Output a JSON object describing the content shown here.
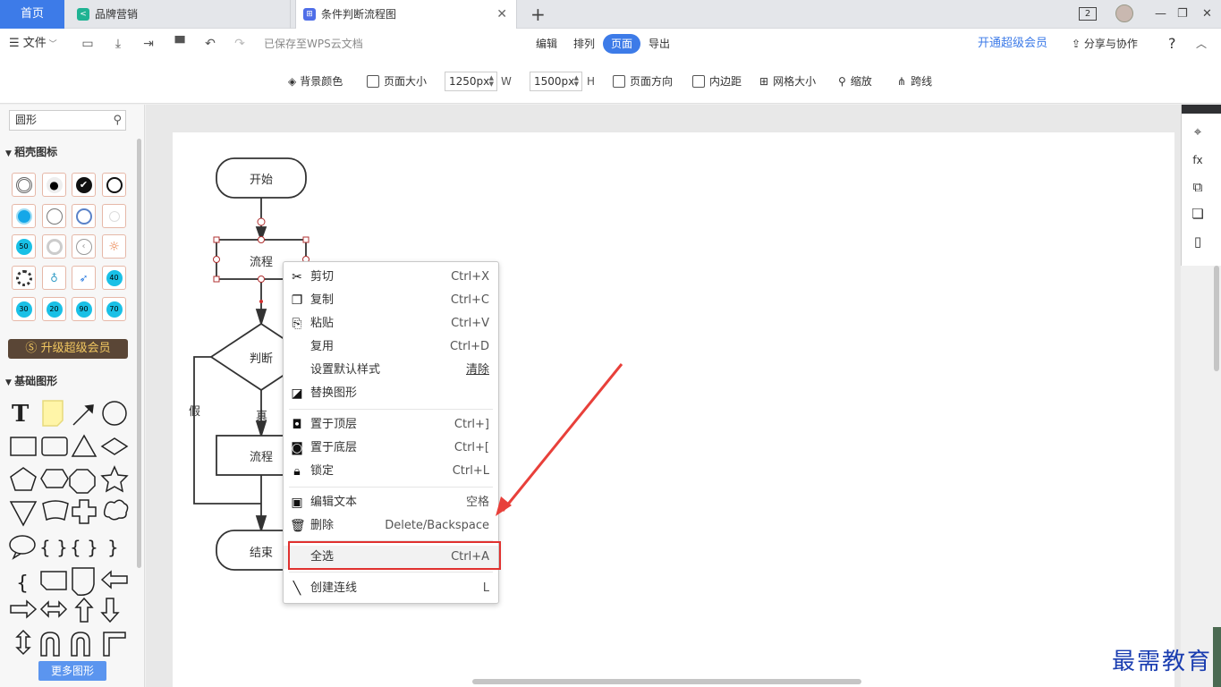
{
  "tabs": {
    "home": "首页",
    "tab1": "品牌营销",
    "tab2": "条件判断流程图",
    "add": "+",
    "close": "✕"
  },
  "window": {
    "count_badge": "2"
  },
  "toolbar": {
    "file": "文件",
    "saved": "已保存至WPS云文档",
    "menu": [
      "编辑",
      "排列",
      "页面",
      "导出"
    ],
    "active_menu": "页面",
    "vip": "开通超级会员",
    "share": "分享与协作",
    "help": "?"
  },
  "page_toolbar": {
    "bg_color": "背景颜色",
    "page_size": "页面大小",
    "width_value": "1250px",
    "width_unit": "W",
    "height_value": "1500px",
    "height_unit": "H",
    "orientation": "页面方向",
    "padding": "内边距",
    "grid_size": "网格大小",
    "zoom": "缩放",
    "jump_line": "跨线"
  },
  "left_panel": {
    "search_value": "圆形",
    "section1": "稻壳图标",
    "section2": "基础图形",
    "upgrade": "升级超级会员",
    "more_shapes": "更多图形",
    "grid_numbers": [
      "50",
      "40",
      "30",
      "20",
      "90",
      "70"
    ]
  },
  "flowchart": {
    "start": "开始",
    "process1": "流程",
    "decision": "判断",
    "yes": "真",
    "no": "假",
    "process2": "流程",
    "end": "结束"
  },
  "context_menu": [
    {
      "label": "剪切",
      "key": "Ctrl+X",
      "icon": "scissors-icon"
    },
    {
      "label": "复制",
      "key": "Ctrl+C",
      "icon": "copy-icon"
    },
    {
      "label": "粘贴",
      "key": "Ctrl+V",
      "icon": "paste-icon"
    },
    {
      "label": "复用",
      "key": "Ctrl+D",
      "icon": ""
    },
    {
      "label": "设置默认样式",
      "key": "清除",
      "icon": ""
    },
    {
      "label": "替换图形",
      "key": "",
      "icon": "replace-shape-icon"
    },
    {
      "label": "置于顶层",
      "key": "Ctrl+]",
      "icon": "bring-front-icon"
    },
    {
      "label": "置于底层",
      "key": "Ctrl+[",
      "icon": "send-back-icon"
    },
    {
      "label": "锁定",
      "key": "Ctrl+L",
      "icon": "lock-icon"
    },
    {
      "label": "编辑文本",
      "key": "空格",
      "icon": "edit-text-icon"
    },
    {
      "label": "删除",
      "key": "Delete/Backspace",
      "icon": "trash-icon"
    },
    {
      "label": "全选",
      "key": "Ctrl+A",
      "icon": ""
    },
    {
      "label": "创建连线",
      "key": "L",
      "icon": "line-icon"
    }
  ],
  "watermark": "最需教育",
  "colors": {
    "accent": "#3d7be8",
    "highlight": "#e0312f",
    "arrow": "#e8403a"
  }
}
